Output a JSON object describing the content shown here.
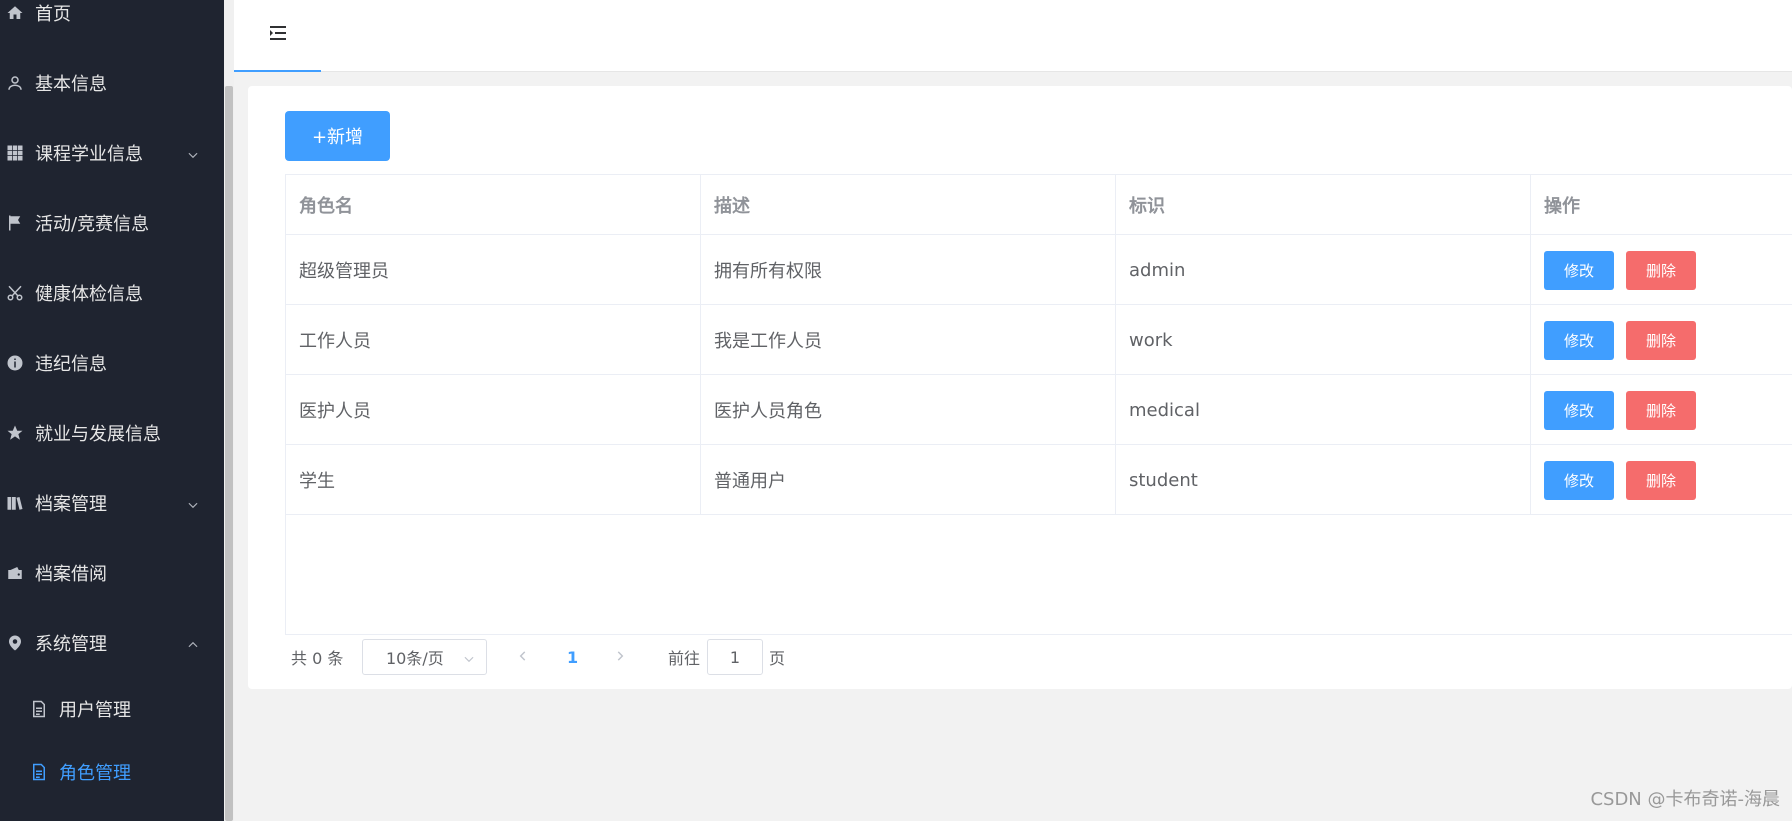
{
  "sidebar": {
    "items": [
      {
        "label": "首页",
        "icon": "home-icon"
      },
      {
        "label": "基本信息",
        "icon": "user-icon"
      },
      {
        "label": "课程学业信息",
        "icon": "grid-icon"
      },
      {
        "label": "活动/竞赛信息",
        "icon": "flag-icon"
      },
      {
        "label": "健康体检信息",
        "icon": "scissors-icon"
      },
      {
        "label": "违纪信息",
        "icon": "info-icon"
      },
      {
        "label": "就业与发展信息",
        "icon": "star-icon"
      },
      {
        "label": "档案管理",
        "icon": "files-icon"
      },
      {
        "label": "档案借阅",
        "icon": "wallet-icon"
      },
      {
        "label": "系统管理",
        "icon": "location-icon"
      },
      {
        "label": "用户管理",
        "icon": "document-icon"
      },
      {
        "label": "角色管理",
        "icon": "document-icon"
      }
    ],
    "active_color": "#409eff"
  },
  "toolbar": {
    "add_label": "+新增"
  },
  "table": {
    "headers": [
      "角色名",
      "描述",
      "标识",
      "操作"
    ],
    "rows": [
      {
        "name": "超级管理员",
        "desc": "拥有所有权限",
        "key": "admin"
      },
      {
        "name": "工作人员",
        "desc": "我是工作人员",
        "key": "work"
      },
      {
        "name": "医护人员",
        "desc": "医护人员角色",
        "key": "medical"
      },
      {
        "name": "学生",
        "desc": "普通用户",
        "key": "student"
      }
    ],
    "edit_label": "修改",
    "delete_label": "删除"
  },
  "pagination": {
    "total_text": "共 0 条",
    "page_size": "10条/页",
    "current_page": "1",
    "goto_label": "前往",
    "goto_value": "1",
    "page_unit": "页"
  },
  "watermark": "CSDN @卡布奇诺-海晨",
  "colors": {
    "primary": "#409eff",
    "danger": "#f56c6c",
    "sidebar_bg": "#1f2430"
  }
}
